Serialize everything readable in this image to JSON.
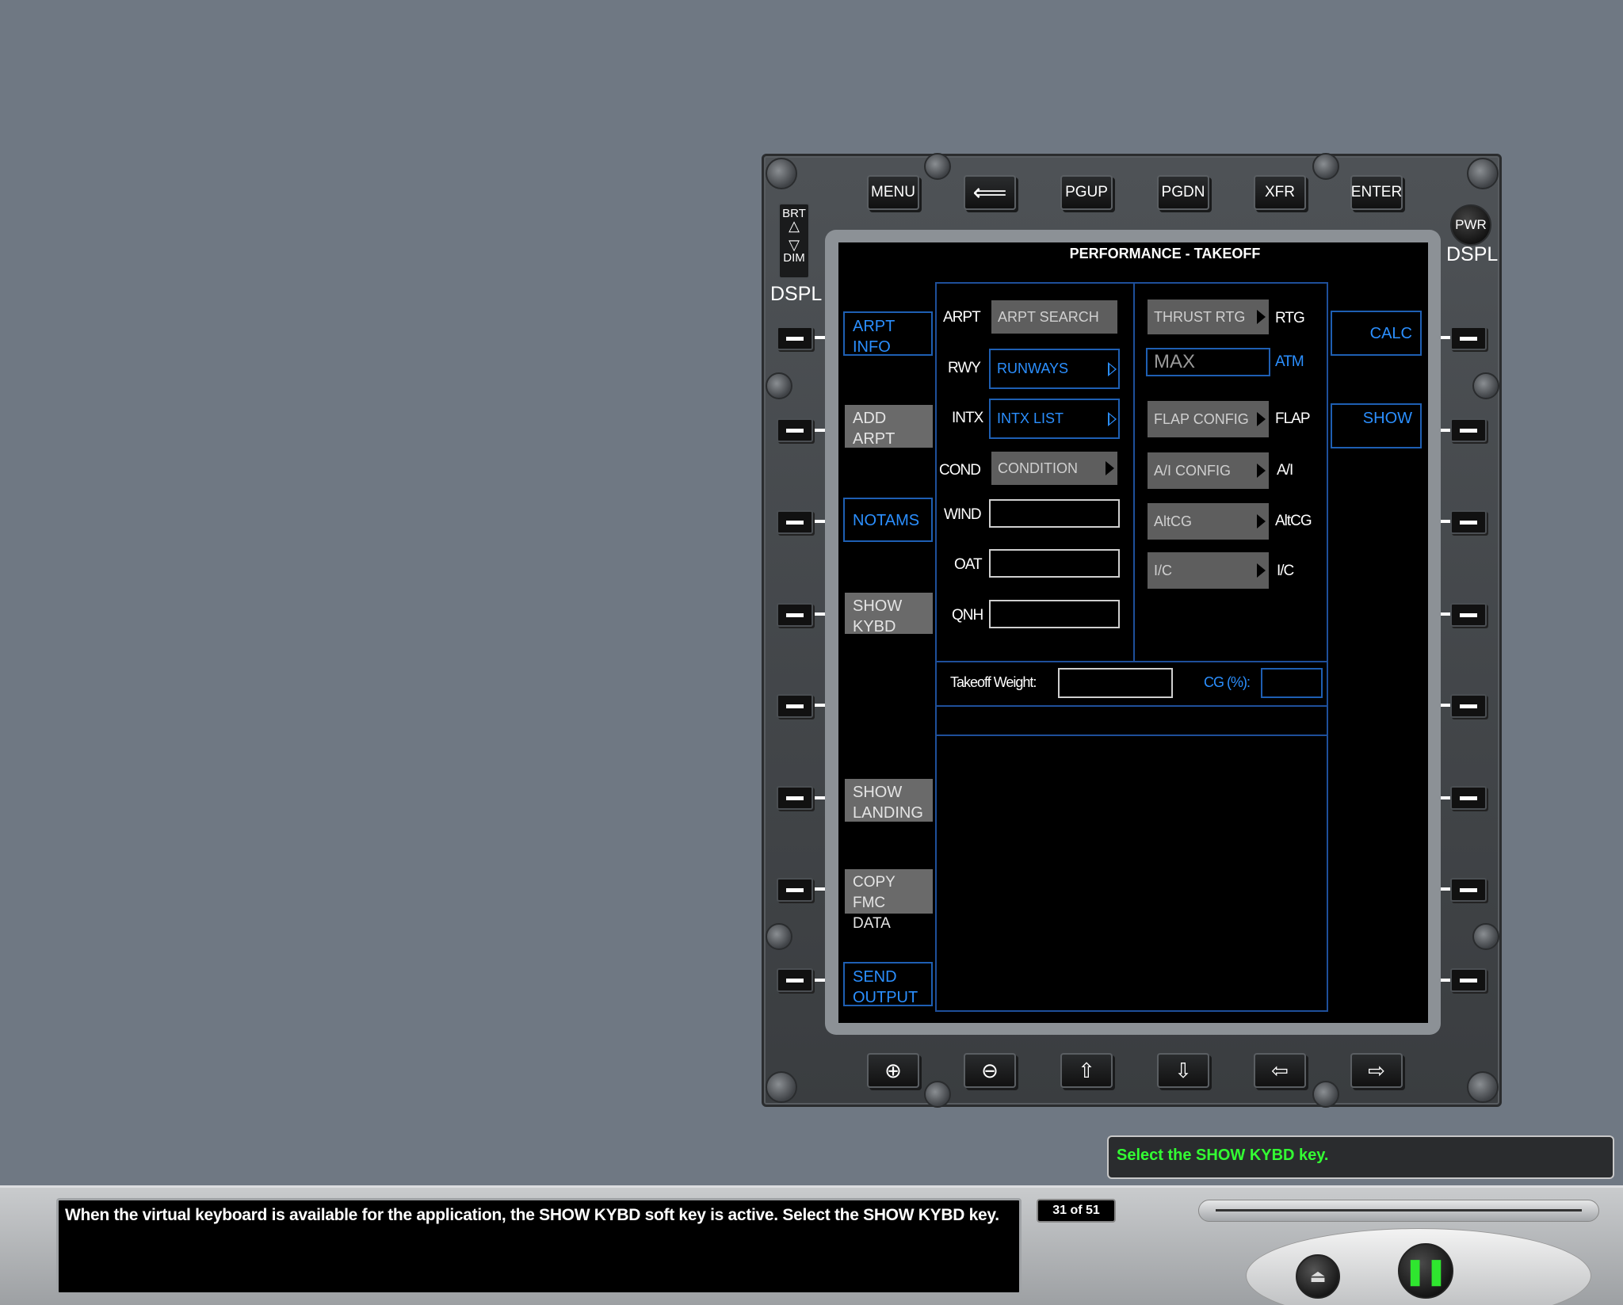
{
  "top_keys": [
    "MENU",
    "⟸",
    "PGUP",
    "PGDN",
    "XFR",
    "ENTER"
  ],
  "bottom_keys": [
    {
      "icon": "zoom-in-icon",
      "glyph": "⊕"
    },
    {
      "icon": "zoom-out-icon",
      "glyph": "⊖"
    },
    {
      "icon": "up-arrow-icon",
      "glyph": "⇧"
    },
    {
      "icon": "down-arrow-icon",
      "glyph": "⇩"
    },
    {
      "icon": "left-arrow-icon",
      "glyph": "⇦"
    },
    {
      "icon": "right-arrow-icon",
      "glyph": "⇨"
    }
  ],
  "left_panel": {
    "brt": "BRT",
    "dim": "DIM",
    "dspl": "DSPL"
  },
  "right_panel": {
    "pwr": "PWR",
    "dspl": "DSPL"
  },
  "screen": {
    "title": "PERFORMANCE - TAKEOFF",
    "left_softkeys": [
      {
        "line1": "ARPT",
        "line2": "INFO",
        "state": "active"
      },
      {
        "line1": "ADD",
        "line2": "ARPT",
        "state": "grey"
      },
      {
        "line1": "NOTAMS",
        "line2": "",
        "state": "active"
      },
      {
        "line1": "SHOW",
        "line2": "KYBD",
        "state": "grey"
      },
      {
        "line1": "SHOW",
        "line2": "LANDING",
        "state": "grey"
      },
      {
        "line1": "COPY",
        "line2": "FMC DATA",
        "state": "grey"
      },
      {
        "line1": "SEND",
        "line2": "OUTPUT",
        "state": "active"
      }
    ],
    "right_softkeys": {
      "calc": "CALC",
      "show": "SHOW"
    },
    "left_rows": [
      {
        "label": "ARPT",
        "value": "ARPT SEARCH"
      },
      {
        "label": "RWY",
        "value": "RUNWAYS"
      },
      {
        "label": "INTX",
        "value": "INTX LIST"
      },
      {
        "label": "COND",
        "value": "CONDITION"
      },
      {
        "label": "WIND",
        "value": ""
      },
      {
        "label": "OAT",
        "value": ""
      },
      {
        "label": "QNH",
        "value": ""
      }
    ],
    "right_rows": [
      {
        "value": "THRUST RTG",
        "label": "RTG"
      },
      {
        "value": "MAX",
        "label": "ATM"
      },
      {
        "value": "FLAP CONFIG",
        "label": "FLAP"
      },
      {
        "value": "A/I CONFIG",
        "label": "A/I"
      },
      {
        "value": "AltCG",
        "label": "AltCG"
      },
      {
        "value": "I/C",
        "label": "I/C"
      }
    ],
    "takeoff_weight_label": "Takeoff Weight:",
    "cg_label": "CG (%):"
  },
  "prompt": "Select the SHOW KYBD key.",
  "narration": "When the virtual keyboard is available for the application, the SHOW KYBD soft key is active. Select the SHOW KYBD key.",
  "counter": "31 of 51",
  "player": {
    "eject_glyph": "⏏",
    "pause_glyph": "❚❚"
  }
}
